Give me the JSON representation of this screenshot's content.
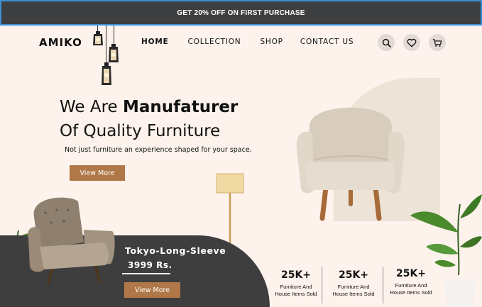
{
  "promo": {
    "text": "GET 20% OFF ON FIRST PURCHASE"
  },
  "header": {
    "logo": "AMIKO",
    "nav": [
      {
        "label": "HOME",
        "active": true
      },
      {
        "label": "COLLECTION",
        "active": false
      },
      {
        "label": "SHOP",
        "active": false
      },
      {
        "label": "CONTACT US",
        "active": false
      }
    ],
    "icons": [
      "search-icon",
      "heart-icon",
      "cart-icon"
    ]
  },
  "hero": {
    "title_line1_regular": "We Are ",
    "title_line1_bold": "Manufaturer",
    "title_line2": "Of Quality Furniture",
    "subtitle": "Not just furniture an experience shaped for your space.",
    "cta_label": "View More"
  },
  "product": {
    "name": "Tokyo-Long-Sleeve",
    "price": "3999 Rs.",
    "cta_label": "View More"
  },
  "stats": [
    {
      "value": "25K+",
      "label_line1": "Furniture And",
      "label_line2": "House Items Sold"
    },
    {
      "value": "25K+",
      "label_line1": "Furniture And",
      "label_line2": "House Items Sold"
    },
    {
      "value": "25K+",
      "label_line1": "Furniture And",
      "label_line2": "House Items Sold"
    }
  ],
  "colors": {
    "accent": "#b07848",
    "promo_bg": "#3e3f40",
    "page_bg": "#fdf2ec",
    "dark_panel": "#3f3e3e",
    "beige_panel": "#ede3d6"
  }
}
